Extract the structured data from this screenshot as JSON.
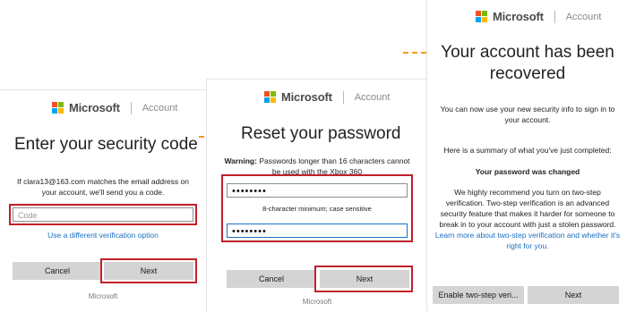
{
  "brand": {
    "name": "Microsoft",
    "section": "Account"
  },
  "logo_colors": [
    "#f25022",
    "#7fba00",
    "#00a4ef",
    "#ffb900"
  ],
  "panel1": {
    "title": "Enter your security code",
    "info": "If clara13@163.com matches the email address on your account, we'll send you a code.",
    "code_placeholder": "Code",
    "alt_link": "Use a different verification option",
    "cancel": "Cancel",
    "next": "Next",
    "footer": "Microsoft"
  },
  "panel2": {
    "title": "Reset your password",
    "warning_label": "Warning:",
    "warning_text": "Passwords longer than 16 characters cannot be used with the Xbox 360",
    "password_value": "••••••••",
    "hint": "8-character minimum; case sensitive",
    "confirm_value": "••••••••",
    "cancel": "Cancel",
    "next": "Next",
    "footer": "Microsoft"
  },
  "panel3": {
    "title": "Your account has been recovered",
    "info": "You can now use your new security info to sign in to your account.",
    "summary": "Here is a summary of what you've just completed:",
    "changed": "Your password was changed",
    "recommend": "We highly recommend you turn on two-step verification. Two-step verification is an advanced security feature that makes it harder for someone to break in to your account with just a stolen password.",
    "learn_more": "Learn more about two-step verification and whether it's right for you.",
    "enable": "Enable two-step veri...",
    "next": "Next"
  }
}
